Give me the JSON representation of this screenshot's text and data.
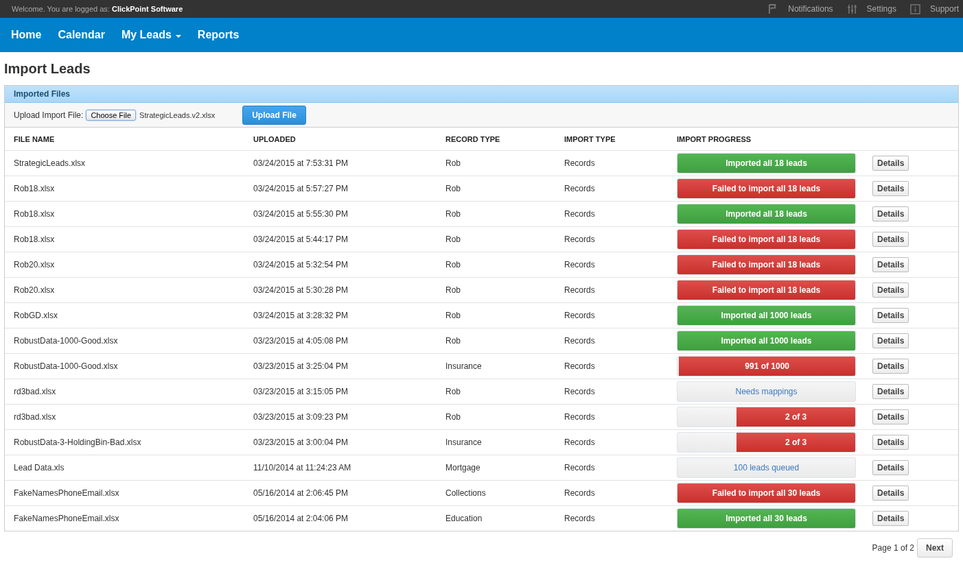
{
  "top_bar": {
    "welcome": "Welcome. You are logged as:",
    "user": "ClickPoint Software",
    "links": [
      {
        "kind": "flag",
        "label": "Notifications"
      },
      {
        "kind": "sliders",
        "label": "Settings"
      },
      {
        "kind": "info",
        "label": "Support"
      }
    ]
  },
  "nav": [
    {
      "label": "Home",
      "dropdown": false
    },
    {
      "label": "Calendar",
      "dropdown": false
    },
    {
      "label": "My Leads",
      "dropdown": true
    },
    {
      "label": "Reports",
      "dropdown": false
    }
  ],
  "page_title": "Import Leads",
  "panel": {
    "title": "Imported Files",
    "upload_label": "Upload Import File:",
    "choose_button": "Choose File",
    "chosen_file": "StrategicLeads.v2.xlsx",
    "upload_button": "Upload File"
  },
  "table": {
    "columns": [
      "FILE NAME",
      "UPLOADED",
      "RECORD TYPE",
      "IMPORT TYPE",
      "IMPORT PROGRESS"
    ],
    "rows": [
      {
        "file": "StrategicLeads.xlsx",
        "uploaded": "03/24/2015 at 7:53:31 PM",
        "record_type": "Rob",
        "import_type": "Records",
        "progress": {
          "kind": "success",
          "level": 1,
          "label": "Imported all 18 leads"
        },
        "action": "Details"
      },
      {
        "file": "Rob18.xlsx",
        "uploaded": "03/24/2015 at 5:57:27 PM",
        "record_type": "Rob",
        "import_type": "Records",
        "progress": {
          "kind": "failure",
          "level": 1,
          "label": "Failed to import all 18 leads"
        },
        "action": "Details"
      },
      {
        "file": "Rob18.xlsx",
        "uploaded": "03/24/2015 at 5:55:30 PM",
        "record_type": "Rob",
        "import_type": "Records",
        "progress": {
          "kind": "success",
          "level": 1,
          "label": "Imported all 18 leads"
        },
        "action": "Details"
      },
      {
        "file": "Rob18.xlsx",
        "uploaded": "03/24/2015 at 5:44:17 PM",
        "record_type": "Rob",
        "import_type": "Records",
        "progress": {
          "kind": "failure",
          "level": 1,
          "label": "Failed to import all 18 leads"
        },
        "action": "Details"
      },
      {
        "file": "Rob20.xlsx",
        "uploaded": "03/24/2015 at 5:32:54 PM",
        "record_type": "Rob",
        "import_type": "Records",
        "progress": {
          "kind": "failure",
          "level": 1,
          "label": "Failed to import all 18 leads"
        },
        "action": "Details"
      },
      {
        "file": "Rob20.xlsx",
        "uploaded": "03/24/2015 at 5:30:28 PM",
        "record_type": "Rob",
        "import_type": "Records",
        "progress": {
          "kind": "failure",
          "level": 1,
          "label": "Failed to import all 18 leads"
        },
        "action": "Details"
      },
      {
        "file": "RobGD.xlsx",
        "uploaded": "03/24/2015 at 3:28:32 PM",
        "record_type": "Rob",
        "import_type": "Records",
        "progress": {
          "kind": "success",
          "level": 1,
          "label": "Imported all 1000 leads"
        },
        "action": "Details"
      },
      {
        "file": "RobustData-1000-Good.xlsx",
        "uploaded": "03/23/2015 at 4:05:08 PM",
        "record_type": "Rob",
        "import_type": "Records",
        "progress": {
          "kind": "success",
          "level": 1,
          "label": "Imported all 1000 leads"
        },
        "action": "Details"
      },
      {
        "file": "RobustData-1000-Good.xlsx",
        "uploaded": "03/23/2015 at 3:25:04 PM",
        "record_type": "Insurance",
        "import_type": "Records",
        "progress": {
          "kind": "failure",
          "level": 0.991,
          "label": "991 of 1000"
        },
        "action": "Details"
      },
      {
        "file": "rd3bad.xlsx",
        "uploaded": "03/23/2015 at 3:15:05 PM",
        "record_type": "Rob",
        "import_type": "Records",
        "progress": {
          "kind": "pending",
          "level": 0,
          "label": "Needs mappings"
        },
        "action": "Details"
      },
      {
        "file": "rd3bad.xlsx",
        "uploaded": "03/23/2015 at 3:09:23 PM",
        "record_type": "Rob",
        "import_type": "Records",
        "progress": {
          "kind": "failure",
          "level": 0.667,
          "label": "2 of 3"
        },
        "action": "Details"
      },
      {
        "file": "RobustData-3-HoldingBin-Bad.xlsx",
        "uploaded": "03/23/2015 at 3:00:04 PM",
        "record_type": "Insurance",
        "import_type": "Records",
        "progress": {
          "kind": "failure",
          "level": 0.667,
          "label": "2 of 3"
        },
        "action": "Details"
      },
      {
        "file": "Lead Data.xls",
        "uploaded": "11/10/2014 at 11:24:23 AM",
        "record_type": "Mortgage",
        "import_type": "Records",
        "progress": {
          "kind": "pending",
          "level": 0,
          "label": "100 leads queued"
        },
        "action": "Details"
      },
      {
        "file": "FakeNamesPhoneEmail.xlsx",
        "uploaded": "05/16/2014 at 2:06:45 PM",
        "record_type": "Collections",
        "import_type": "Records",
        "progress": {
          "kind": "failure",
          "level": 1,
          "label": "Failed to import all 30 leads"
        },
        "action": "Details"
      },
      {
        "file": "FakeNamesPhoneEmail.xlsx",
        "uploaded": "05/16/2014 at 2:04:06 PM",
        "record_type": "Education",
        "import_type": "Records",
        "progress": {
          "kind": "success",
          "level": 1,
          "label": "Imported all 30 leads"
        },
        "action": "Details"
      }
    ]
  },
  "pagination": {
    "page_info": "Page 1 of 2",
    "next": "Next"
  }
}
